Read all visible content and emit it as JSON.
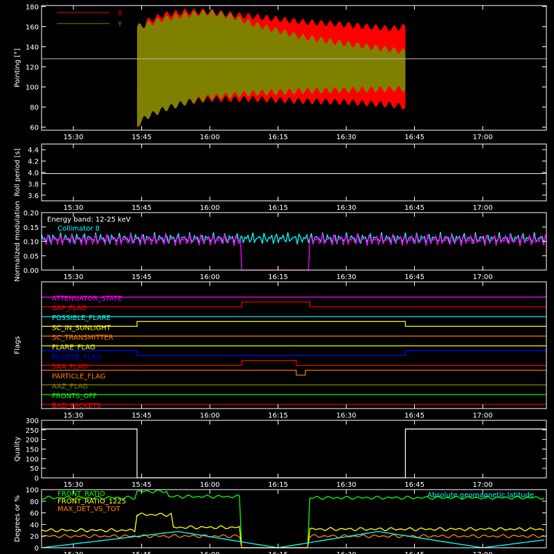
{
  "time_ticks": [
    "15:30",
    "15:45",
    "16:00",
    "16:15",
    "16:30",
    "16:45",
    "17:00"
  ],
  "chart_data": [
    {
      "type": "area",
      "ylabel": "Pointing [°]",
      "xlim": [
        "15:23",
        "17:14"
      ],
      "ylim": [
        57,
        181
      ],
      "yticks": [
        60,
        80,
        100,
        120,
        140,
        160,
        180
      ],
      "reference_line": 128,
      "series": [
        {
          "name": "X",
          "color": "#ff0000",
          "x": [
            "15:44",
            "15:46",
            "15:50",
            "15:55",
            "16:00",
            "16:05",
            "16:10",
            "16:20",
            "16:30",
            "16:40",
            "16:43"
          ],
          "upper": [
            100,
            165,
            172,
            175,
            175,
            172,
            170,
            165,
            162,
            158,
            160
          ],
          "lower": [
            60,
            78,
            82,
            85,
            88,
            88,
            88,
            86,
            85,
            82,
            80
          ]
        },
        {
          "name": "Y",
          "color": "#808000",
          "x": [
            "15:44",
            "15:46",
            "15:50",
            "15:55",
            "16:00",
            "16:05",
            "16:10",
            "16:20",
            "16:30",
            "16:40",
            "16:43"
          ],
          "upper": [
            160,
            162,
            168,
            172,
            174,
            170,
            162,
            150,
            143,
            137,
            135
          ],
          "lower": [
            62,
            70,
            78,
            85,
            90,
            92,
            94,
            96,
            97,
            98,
            98
          ]
        }
      ]
    },
    {
      "type": "line",
      "ylabel": "Roll period [s]",
      "ylim": [
        3.5,
        4.5
      ],
      "yticks": [
        "3.6",
        "3.8",
        "4.0",
        "4.2",
        "4.4"
      ],
      "series": [
        {
          "name": "",
          "color": "#ffffff",
          "x": [
            "15:23",
            "17:14"
          ],
          "values": [
            3.98,
            3.98
          ]
        }
      ]
    },
    {
      "type": "line",
      "ylabel": "Normalized modulation",
      "ylim": [
        0,
        0.2
      ],
      "yticks": [
        "0.00",
        "0.05",
        "0.10",
        "0.15",
        "0.20"
      ],
      "annotation": "Energy band: 12-25 keV",
      "series": [
        {
          "name": "Collimator 8",
          "color": "#00ffff",
          "x": [
            "15:23",
            "16:07",
            "16:22",
            "17:14"
          ],
          "values": [
            0.11,
            0.11,
            0.11,
            0.11
          ]
        },
        {
          "name": "",
          "color": "#ff00ff",
          "x": [
            "15:23",
            "16:07",
            "16:07",
            "16:22",
            "16:22",
            "17:14"
          ],
          "values": [
            0.105,
            0.105,
            0,
            0,
            0.105,
            0.105
          ]
        }
      ]
    },
    {
      "type": "line",
      "ylabel": "Flags",
      "flags": [
        {
          "name": "ATTENUATOR_STATE",
          "color": "#ff00ff",
          "segments": [
            [
              "15:23",
              "17:14",
              0
            ]
          ]
        },
        {
          "name": "SAP_FLAG",
          "color": "#ff0000",
          "segments": [
            [
              "15:23",
              "16:07",
              0
            ],
            [
              "16:07",
              "16:22",
              1
            ],
            [
              "16:22",
              "17:14",
              0
            ]
          ]
        },
        {
          "name": "POSSIBLE_FLARE",
          "color": "#00ffff",
          "segments": [
            [
              "15:23",
              "17:14",
              0
            ]
          ]
        },
        {
          "name": "SC_IN_SUNLIGHT",
          "color": "#ffff00",
          "segments": [
            [
              "15:23",
              "15:44",
              0
            ],
            [
              "15:44",
              "16:43",
              1
            ],
            [
              "16:43",
              "17:14",
              0
            ]
          ]
        },
        {
          "name": "SC_TRANSMITTER",
          "color": "#ff8000",
          "segments": [
            [
              "15:23",
              "17:14",
              0
            ]
          ]
        },
        {
          "name": "FLARE_FLAG",
          "color": "#ffff00",
          "segments": [
            [
              "15:23",
              "17:14",
              0
            ]
          ]
        },
        {
          "name": "ECLIPSE_FLAG",
          "color": "#0000ff",
          "segments": [
            [
              "15:23",
              "15:44",
              1
            ],
            [
              "15:44",
              "16:43",
              0
            ],
            [
              "16:43",
              "17:14",
              1
            ]
          ]
        },
        {
          "name": "SAA_FLAG",
          "color": "#ff0000",
          "segments": [
            [
              "15:23",
              "16:07",
              0
            ],
            [
              "16:07",
              "16:19",
              1
            ],
            [
              "16:19",
              "17:14",
              0
            ]
          ]
        },
        {
          "name": "PARTICLE_FLAG",
          "color": "#ff8000",
          "segments": [
            [
              "15:23",
              "16:19",
              1
            ],
            [
              "16:19",
              "16:21",
              0
            ],
            [
              "16:21",
              "17:14",
              1
            ]
          ]
        },
        {
          "name": "AAZ_FLAG",
          "color": "#808000",
          "segments": [
            [
              "15:23",
              "17:14",
              0
            ]
          ]
        },
        {
          "name": "FRONTS_OFF",
          "color": "#00ff00",
          "segments": [
            [
              "15:23",
              "17:14",
              0
            ]
          ]
        },
        {
          "name": "BAD_PACKETS",
          "color": "#ff0000",
          "segments": [
            [
              "15:23",
              "17:14",
              0
            ]
          ]
        }
      ]
    },
    {
      "type": "line",
      "ylabel": "Quality",
      "ylim": [
        0,
        300
      ],
      "yticks": [
        "0",
        "50",
        "100",
        "150",
        "200",
        "250",
        "300"
      ],
      "series": [
        {
          "name": "",
          "color": "#ffffff",
          "x": [
            "15:23",
            "15:44",
            "15:44",
            "16:43",
            "16:43",
            "17:14"
          ],
          "values": [
            255,
            255,
            0,
            0,
            255,
            255
          ]
        }
      ]
    },
    {
      "type": "line",
      "ylabel": "Degrees or %",
      "ylim": [
        0,
        100
      ],
      "yticks": [
        "0",
        "20",
        "40",
        "60",
        "80",
        "100"
      ],
      "series": [
        {
          "name": "FRONT_RATIO",
          "color": "#00ff00",
          "x": [
            "15:23",
            "15:44",
            "15:44",
            "15:51",
            "15:51",
            "16:07",
            "16:07",
            "16:22",
            "16:22",
            "17:14"
          ],
          "values": [
            86,
            86,
            97,
            97,
            88,
            88,
            0,
            0,
            86,
            86
          ]
        },
        {
          "name": "FRONT_RATIO_1225",
          "color": "#ffff00",
          "x": [
            "15:23",
            "15:44",
            "15:44",
            "15:52",
            "15:52",
            "16:07",
            "16:07",
            "16:22",
            "16:22",
            "17:14"
          ],
          "values": [
            30,
            30,
            57,
            57,
            35,
            35,
            0,
            0,
            32,
            32
          ]
        },
        {
          "name": "MAX_DET_VS_TOT",
          "color": "#ff8000",
          "x": [
            "15:23",
            "16:07",
            "16:07",
            "16:22",
            "16:22",
            "17:14"
          ],
          "values": [
            20,
            20,
            0,
            0,
            20,
            20
          ]
        },
        {
          "name": "Absolute geomagnetic latitude",
          "color": "#00ffff",
          "x": [
            "15:23",
            "15:53",
            "16:15",
            "16:37",
            "17:00",
            "17:14"
          ],
          "values": [
            0,
            28,
            0,
            28,
            0,
            14
          ]
        }
      ]
    }
  ]
}
